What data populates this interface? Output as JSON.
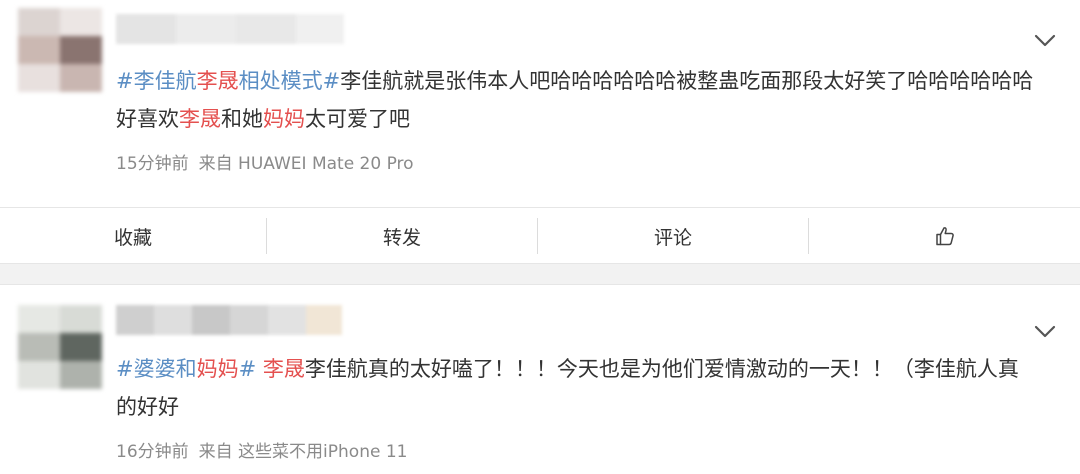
{
  "posts": [
    {
      "content": {
        "tag1": "#李佳航",
        "hl1": "李晟",
        "tag1_end": "相处模式#",
        "text1": "李佳航就是张伟本人吧哈哈哈哈哈哈被整蛊吃面那段太好笑了哈哈哈哈哈哈好喜欢",
        "hl2": "李晟",
        "text2": "和她",
        "hl3": "妈妈",
        "text3": "太可爱了吧"
      },
      "meta": {
        "time": "15分钟前",
        "source": "来自 HUAWEI Mate 20 Pro"
      }
    },
    {
      "content": {
        "tag1": "#婆婆和",
        "hl1": "妈妈",
        "tag1_end": "#",
        "hl2": "李晟",
        "text1": "李佳航真的太好嗑了！！！今天也是为他们爱情激动的一天！！（李佳航人真的好好"
      },
      "meta": {
        "time": "16分钟前",
        "source": "来自 这些菜不用iPhone 11"
      }
    }
  ],
  "actions": {
    "favorite": "收藏",
    "repost": "转发",
    "comment": "评论"
  },
  "icons": {
    "menu": "chevron-down-icon",
    "like": "thumbs-up-icon"
  },
  "colors": {
    "hashtag": "#5b8ec4",
    "highlight": "#e4504f",
    "meta": "#8a8a8a",
    "divider": "#e6e6e6",
    "gap": "#f2f2f2"
  }
}
